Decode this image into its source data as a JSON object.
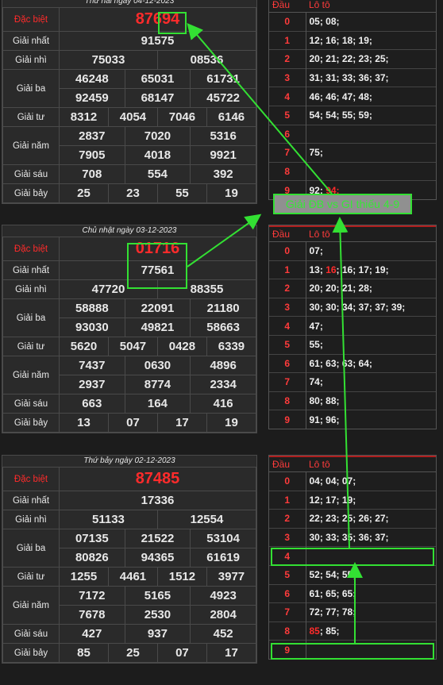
{
  "labels": {
    "db": "Đặc biệt",
    "g1": "Giải nhất",
    "g2": "Giải nhì",
    "g3": "Giải ba",
    "g4": "Giải tư",
    "g5": "Giải năm",
    "g6": "Giải sáu",
    "g7": "Giải bảy"
  },
  "draws": [
    {
      "title": "Thứ hai ngày 04-12-2023",
      "db": "87694",
      "g1": "91575",
      "g2": [
        "75033",
        "08536"
      ],
      "g3": [
        "46248",
        "65031",
        "61731",
        "92459",
        "68147",
        "45722"
      ],
      "g4": [
        "8312",
        "4054",
        "7046",
        "6146"
      ],
      "g5": [
        "2837",
        "7020",
        "5316",
        "7905",
        "4018",
        "9921"
      ],
      "g6": [
        "708",
        "554",
        "392"
      ],
      "g7": [
        "25",
        "23",
        "55",
        "19"
      ]
    },
    {
      "title": "Chủ nhật ngày 03-12-2023",
      "db": "01716",
      "g1": "77561",
      "g2": [
        "47720",
        "88355"
      ],
      "g3": [
        "58888",
        "22091",
        "21180",
        "93030",
        "49821",
        "58663"
      ],
      "g4": [
        "5620",
        "5047",
        "0428",
        "6339"
      ],
      "g5": [
        "7437",
        "0630",
        "4896",
        "2937",
        "8774",
        "2334"
      ],
      "g6": [
        "663",
        "164",
        "416"
      ],
      "g7": [
        "13",
        "07",
        "17",
        "19"
      ]
    },
    {
      "title": "Thứ bảy ngày 02-12-2023",
      "db": "87485",
      "g1": "17336",
      "g2": [
        "51133",
        "12554"
      ],
      "g3": [
        "07135",
        "21522",
        "53104",
        "80826",
        "94365",
        "61619"
      ],
      "g4": [
        "1255",
        "4461",
        "1512",
        "3977"
      ],
      "g5": [
        "7172",
        "5165",
        "4923",
        "7678",
        "2530",
        "2804"
      ],
      "g6": [
        "427",
        "937",
        "452"
      ],
      "g7": [
        "85",
        "25",
        "07",
        "17"
      ]
    }
  ],
  "loto_header": {
    "dau": "Đầu",
    "loto": "Lô tô"
  },
  "lotos": [
    [
      {
        "d": "0",
        "v": "05; 08;"
      },
      {
        "d": "1",
        "v": "12; 16; 18; 19;"
      },
      {
        "d": "2",
        "v": "20; 21; 22; 23; 25;"
      },
      {
        "d": "3",
        "v": "31; 31; 33; 36; 37;"
      },
      {
        "d": "4",
        "v": "46; 46; 47; 48;"
      },
      {
        "d": "5",
        "v": "54; 54; 55; 59;"
      },
      {
        "d": "6",
        "v": ""
      },
      {
        "d": "7",
        "v": "75;"
      },
      {
        "d": "8",
        "v": ""
      },
      {
        "d": "9",
        "v": "92; ",
        "hot": "94;"
      }
    ],
    [
      {
        "d": "0",
        "v": "07;"
      },
      {
        "d": "1",
        "v": "13; ",
        "hot": "16",
        "rest": "; 16; 17; 19;"
      },
      {
        "d": "2",
        "v": "20; 20; 21; 28;"
      },
      {
        "d": "3",
        "v": "30; 30; 34; 37; 37; 39;"
      },
      {
        "d": "4",
        "v": "47;"
      },
      {
        "d": "5",
        "v": "55;"
      },
      {
        "d": "6",
        "v": "61; 63; 63; 64;"
      },
      {
        "d": "7",
        "v": "74;"
      },
      {
        "d": "8",
        "v": "80; 88;"
      },
      {
        "d": "9",
        "v": "91; 96;"
      }
    ],
    [
      {
        "d": "0",
        "v": "04; 04; 07;"
      },
      {
        "d": "1",
        "v": "12; 17; 19;"
      },
      {
        "d": "2",
        "v": "22; 23; 25; 26; 27;"
      },
      {
        "d": "3",
        "v": "30; 33; 35; 36; 37;"
      },
      {
        "d": "4",
        "v": ""
      },
      {
        "d": "5",
        "v": "52; 54; 55;"
      },
      {
        "d": "6",
        "v": "61; 65; 65;"
      },
      {
        "d": "7",
        "v": "72; 77; 78;"
      },
      {
        "d": "8",
        "v": "",
        "hot": "85",
        "rest": "; 85;"
      },
      {
        "d": "9",
        "v": ""
      }
    ]
  ],
  "annotation": {
    "text": "Giải ĐB vs GI thiếu 4-9",
    "color": "#33e033"
  }
}
